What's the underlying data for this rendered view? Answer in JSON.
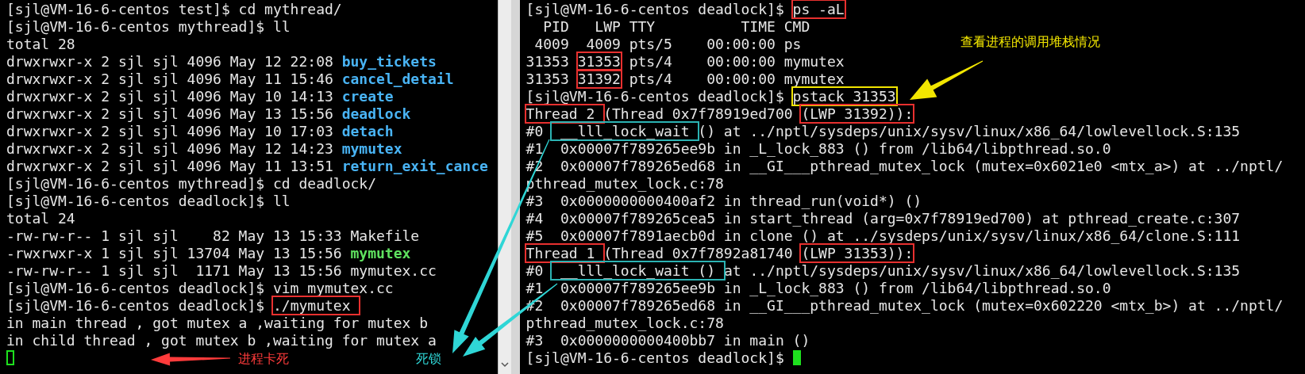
{
  "left_terminal": {
    "lines": [
      [
        {
          "kind": "text",
          "text": "[sjl@VM-16-6-centos test]$ cd mythread/"
        }
      ],
      [
        {
          "kind": "text",
          "text": "[sjl@VM-16-6-centos mythread]$ ll"
        }
      ],
      [
        {
          "kind": "text",
          "text": "total 28"
        }
      ],
      [
        {
          "kind": "text",
          "text": "drwxrwxr-x 2 sjl sjl 4096 May 12 22:08 "
        },
        {
          "kind": "directory",
          "text": "buy_tickets"
        }
      ],
      [
        {
          "kind": "text",
          "text": "drwxrwxr-x 2 sjl sjl 4096 May 11 15:46 "
        },
        {
          "kind": "directory",
          "text": "cancel_detail"
        }
      ],
      [
        {
          "kind": "text",
          "text": "drwxrwxr-x 2 sjl sjl 4096 May 10 14:13 "
        },
        {
          "kind": "directory",
          "text": "create"
        }
      ],
      [
        {
          "kind": "text",
          "text": "drwxrwxr-x 2 sjl sjl 4096 May 13 15:56 "
        },
        {
          "kind": "directory",
          "text": "deadlock"
        }
      ],
      [
        {
          "kind": "text",
          "text": "drwxrwxr-x 2 sjl sjl 4096 May 10 17:03 "
        },
        {
          "kind": "directory",
          "text": "detach"
        }
      ],
      [
        {
          "kind": "text",
          "text": "drwxrwxr-x 2 sjl sjl 4096 May 12 14:23 "
        },
        {
          "kind": "directory",
          "text": "mymutex"
        }
      ],
      [
        {
          "kind": "text",
          "text": "drwxrwxr-x 2 sjl sjl 4096 May 11 13:51 "
        },
        {
          "kind": "directory",
          "text": "return_exit_cance"
        }
      ],
      [
        {
          "kind": "text",
          "text": "[sjl@VM-16-6-centos mythread]$ cd deadlock/"
        }
      ],
      [
        {
          "kind": "text",
          "text": "[sjl@VM-16-6-centos deadlock]$ ll"
        }
      ],
      [
        {
          "kind": "text",
          "text": "total 24"
        }
      ],
      [
        {
          "kind": "text",
          "text": "-rw-rw-r-- 1 sjl sjl    82 May 13 15:33 Makefile"
        }
      ],
      [
        {
          "kind": "text",
          "text": "-rwxrwxr-x 1 sjl sjl 13704 May 13 15:56 "
        },
        {
          "kind": "executable",
          "text": "mymutex"
        }
      ],
      [
        {
          "kind": "text",
          "text": "-rw-rw-r-- 1 sjl sjl  1171 May 13 15:56 mymutex.cc"
        }
      ],
      [
        {
          "kind": "text",
          "text": "[sjl@VM-16-6-centos deadlock]$ vim mymutex.cc"
        }
      ],
      [
        {
          "kind": "text",
          "text": "[sjl@VM-16-6-centos deadlock]$ "
        },
        {
          "kind": "text",
          "text": "./mymutex ",
          "color": "#e8302f"
        }
      ],
      [
        {
          "kind": "text",
          "text": "in main thread , got mutex a ,waiting for mutex b"
        }
      ],
      [
        {
          "kind": "text",
          "text": "in child thread , got mutex b ,waiting for mutex a"
        }
      ],
      [
        {
          "kind": "cursor",
          "focused": false
        }
      ]
    ]
  },
  "right_terminal": {
    "lines": [
      [
        {
          "kind": "text",
          "text": "[sjl@VM-16-6-centos deadlock]$ "
        },
        {
          "kind": "text",
          "text": "ps -aL",
          "color": "#e8302f"
        }
      ],
      [
        {
          "kind": "text",
          "text": "  PID   LWP TTY          TIME CMD"
        }
      ],
      [
        {
          "kind": "text",
          "text": " 4009  4009 pts/5    00:00:00 ps"
        }
      ],
      [
        {
          "kind": "text",
          "text": "31353 "
        },
        {
          "kind": "text",
          "text": "31353",
          "color": "#e8302f"
        },
        {
          "kind": "text",
          "text": " pts/4    00:00:00 mymutex"
        }
      ],
      [
        {
          "kind": "text",
          "text": "31353 "
        },
        {
          "kind": "text",
          "text": "31392",
          "color": "#e8302f"
        },
        {
          "kind": "text",
          "text": " pts/4    00:00:00 mymutex"
        }
      ],
      [
        {
          "kind": "text",
          "text": "[sjl@VM-16-6-centos deadlock]$ "
        },
        {
          "kind": "text",
          "text": "pstack 31353",
          "color": "#f2e600"
        }
      ],
      [
        {
          "kind": "text",
          "text": "Thread 2 ",
          "color": "#e8302f"
        },
        {
          "kind": "text",
          "text": "(Thread 0x7f78919ed700 "
        },
        {
          "kind": "text",
          "text": "(LWP 31392)):",
          "color": "#e8302f"
        }
      ],
      [
        {
          "kind": "text",
          "text": "#0 "
        },
        {
          "kind": "text",
          "text": " __lll_lock_wait ",
          "color": "#2bb3b3"
        },
        {
          "kind": "text",
          "text": "() at ../nptl/sysdeps/unix/sysv/linux/x86_64/lowlevellock.S:135"
        }
      ],
      [
        {
          "kind": "text",
          "text": "#1  0x00007f789265ee9b in _L_lock_883 () from /lib64/libpthread.so.0"
        }
      ],
      [
        {
          "kind": "text",
          "text": "#2  0x00007f789265ed68 in __GI___pthread_mutex_lock (mutex=0x6021e0 <mtx_a>) at ../nptl/"
        }
      ],
      [
        {
          "kind": "text",
          "text": "pthread_mutex_lock.c:78"
        }
      ],
      [
        {
          "kind": "text",
          "text": "#3  0x0000000000400af2 in thread_run(void*) ()"
        }
      ],
      [
        {
          "kind": "text",
          "text": "#4  0x00007f789265cea5 in start_thread (arg=0x7f78919ed700) at pthread_create.c:307"
        }
      ],
      [
        {
          "kind": "text",
          "text": "#5  0x00007f7891aecb0d in clone () at ../sysdeps/unix/sysv/linux/x86_64/clone.S:111"
        }
      ],
      [
        {
          "kind": "text",
          "text": "Thread 1 ",
          "color": "#e8302f"
        },
        {
          "kind": "text",
          "text": "(Thread 0x7f7892a81740 "
        },
        {
          "kind": "text",
          "text": "(LWP 31353)):",
          "color": "#e8302f"
        }
      ],
      [
        {
          "kind": "text",
          "text": "#0 "
        },
        {
          "kind": "text",
          "text": " __lll_lock_wait () ",
          "color": "#2bb3b3"
        },
        {
          "kind": "text",
          "text": "at ../nptl/sysdeps/unix/sysv/linux/x86_64/lowlevellock.S:135"
        }
      ],
      [
        {
          "kind": "text",
          "text": "#1  0x00007f789265ee9b in _L_lock_883 () from /lib64/libpthread.so.0"
        }
      ],
      [
        {
          "kind": "text",
          "text": "#2  0x00007f789265ed68 in __GI___pthread_mutex_lock (mutex=0x602220 <mtx_b>) at ../nptl/"
        }
      ],
      [
        {
          "kind": "text",
          "text": "pthread_mutex_lock.c:78"
        }
      ],
      [
        {
          "kind": "text",
          "text": "#3  0x0000000000400bb7 in main ()"
        }
      ],
      [
        {
          "kind": "text",
          "text": "[sjl@VM-16-6-centos deadlock]$ "
        },
        {
          "kind": "cursor",
          "focused": true
        }
      ]
    ]
  },
  "annotations": [
    {
      "text": "查看进程的调用堆栈情况",
      "color": "#f2e600"
    },
    {
      "text": "进程卡死",
      "color": "#ff3b3b"
    },
    {
      "text": "死锁",
      "color": "#2fd6d6"
    }
  ]
}
